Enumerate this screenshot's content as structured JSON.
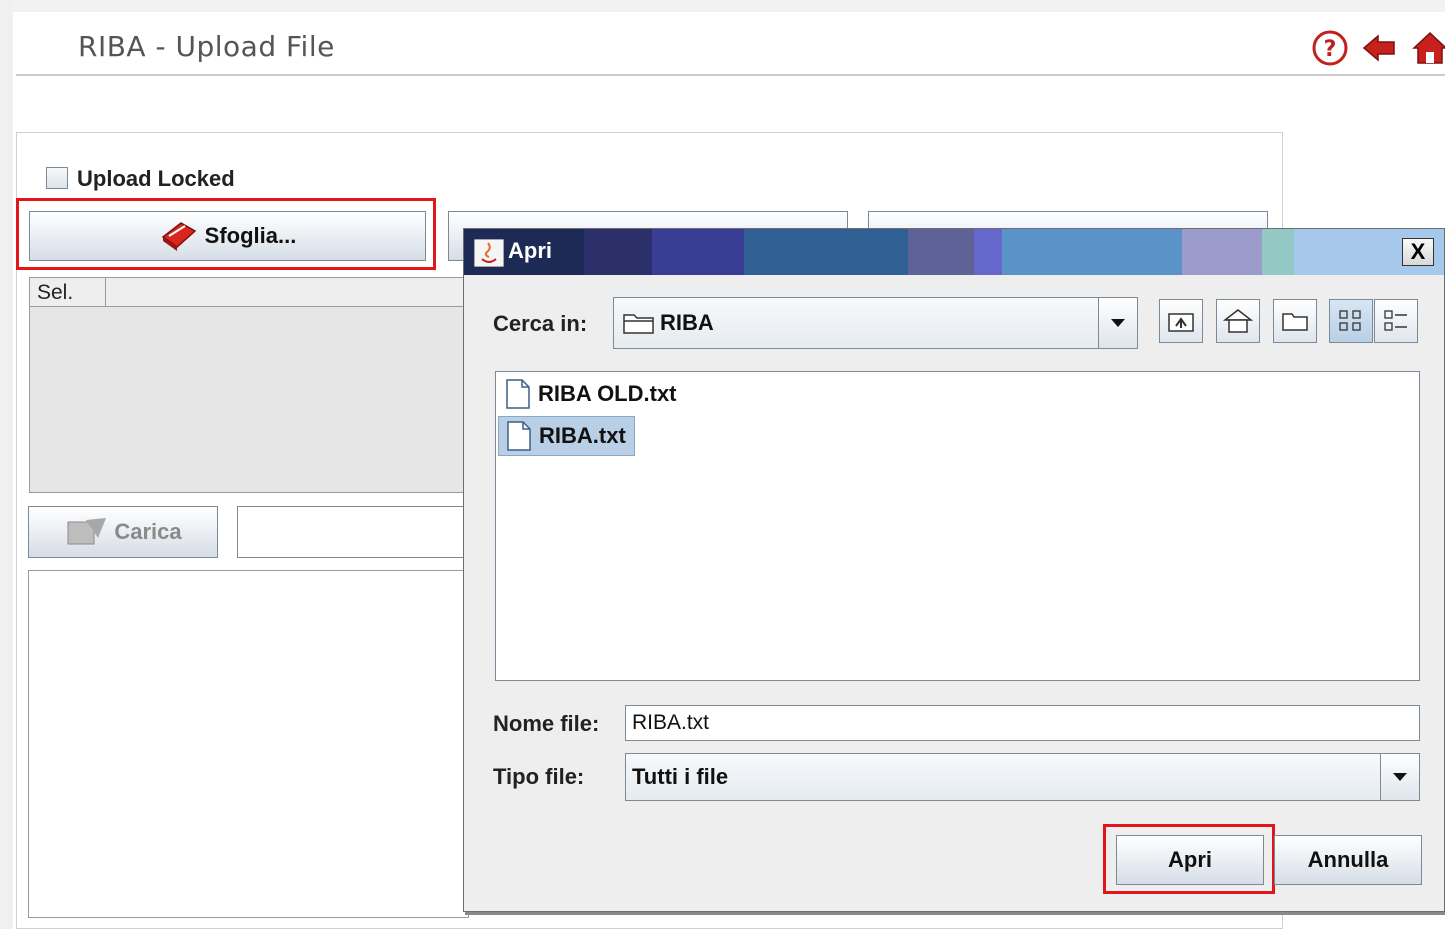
{
  "header": {
    "title": "RIBA - Upload File",
    "icons": [
      "help-icon",
      "back-icon",
      "home-icon"
    ]
  },
  "panel": {
    "upload_locked_label": "Upload Locked",
    "sfoglia_label": "Sfoglia...",
    "table_header_sel": "Sel.",
    "carica_label": "Carica"
  },
  "dialog": {
    "title": "Apri",
    "look_in_label": "Cerca in:",
    "look_in_value": "RIBA",
    "files": [
      {
        "name": "RIBA OLD.txt",
        "selected": false
      },
      {
        "name": "RIBA.txt",
        "selected": true
      }
    ],
    "file_name_label": "Nome file:",
    "file_name_value": "RIBA.txt",
    "file_type_label": "Tipo file:",
    "file_type_value": "Tutti i file",
    "open_label": "Apri",
    "cancel_label": "Annulla",
    "close_glyph": "X"
  },
  "colors": {
    "highlight": "#e0161b",
    "selection": "#b8cfe5"
  }
}
